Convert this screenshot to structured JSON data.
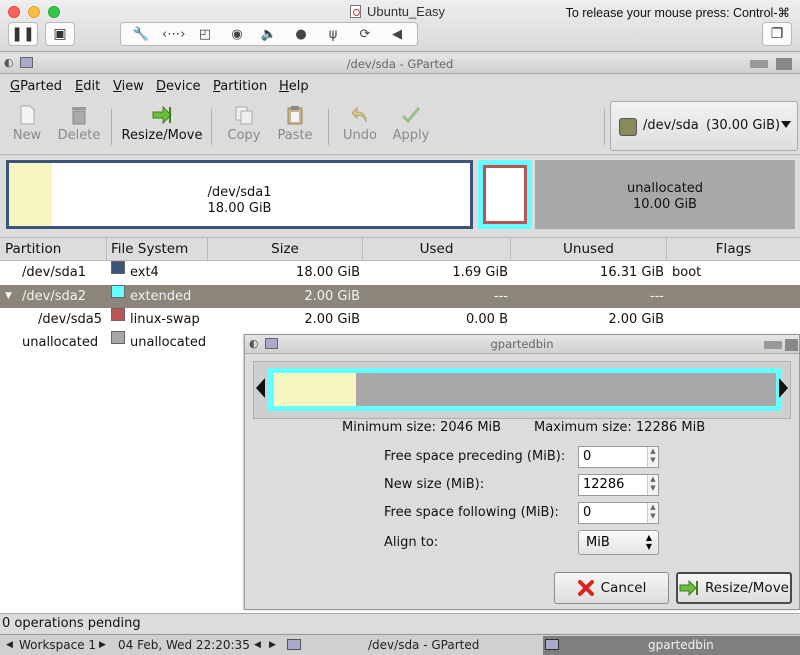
{
  "host": {
    "title": "Ubuntu_Easy",
    "release_hint": "To release your mouse press: Control-⌘",
    "toolbar_icons": [
      "wrench-icon",
      "arrows-icon",
      "disk-icon",
      "camera-icon",
      "speaker-icon",
      "record-icon",
      "usb-icon",
      "sync-icon",
      "chevron-left-icon"
    ]
  },
  "window": {
    "title": "/dev/sda - GParted"
  },
  "menu": {
    "gparted": "GParted",
    "edit": "Edit",
    "view": "View",
    "device": "Device",
    "partition": "Partition",
    "help": "Help"
  },
  "toolbar": {
    "new": "New",
    "delete": "Delete",
    "resize": "Resize/Move",
    "copy": "Copy",
    "paste": "Paste",
    "undo": "Undo",
    "apply": "Apply"
  },
  "device_selector": {
    "name": "/dev/sda",
    "size": "(30.00 GiB)"
  },
  "disk_map": {
    "sda1_name": "/dev/sda1",
    "sda1_size": "18.00 GiB",
    "unalloc_name": "unallocated",
    "unalloc_size": "10.00 GiB",
    "sda1_used_fraction": 0.094
  },
  "table": {
    "headers": [
      "Partition",
      "File System",
      "Size",
      "Used",
      "Unused",
      "Flags"
    ],
    "rows": [
      {
        "partition": "/dev/sda1",
        "fs": "ext4",
        "color": "#3a5577",
        "size": "18.00 GiB",
        "used": "1.69 GiB",
        "unused": "16.31 GiB",
        "flags": "boot"
      },
      {
        "partition": "/dev/sda2",
        "fs": "extended",
        "color": "#66ffff",
        "size": "2.00 GiB",
        "used": "---",
        "unused": "---",
        "flags": ""
      },
      {
        "partition": "/dev/sda5",
        "fs": "linux-swap",
        "color": "#bb5555",
        "size": "2.00 GiB",
        "used": "0.00 B",
        "unused": "2.00 GiB",
        "flags": ""
      },
      {
        "partition": "unallocated",
        "fs": "unallocated",
        "color": "#a8a8a8",
        "size": "",
        "used": "",
        "unused": "",
        "flags": ""
      }
    ]
  },
  "dialog": {
    "title": "gpartedbin",
    "min_size": "Minimum size: 2046 MiB",
    "max_size": "Maximum size: 12286 MiB",
    "free_before_label": "Free space preceding (MiB):",
    "free_before_value": "0",
    "new_size_label": "New size (MiB):",
    "new_size_value": "12286",
    "free_after_label": "Free space following (MiB):",
    "free_after_value": "0",
    "align_label": "Align to:",
    "align_value": "MiB",
    "cancel": "Cancel",
    "resize": "Resize/Move"
  },
  "status": {
    "text": "0 operations pending"
  },
  "taskbar": {
    "workspace": "Workspace 1",
    "clock": "04 Feb, Wed 22:20:35",
    "task1": "/dev/sda - GParted",
    "task2": "gpartedbin"
  }
}
